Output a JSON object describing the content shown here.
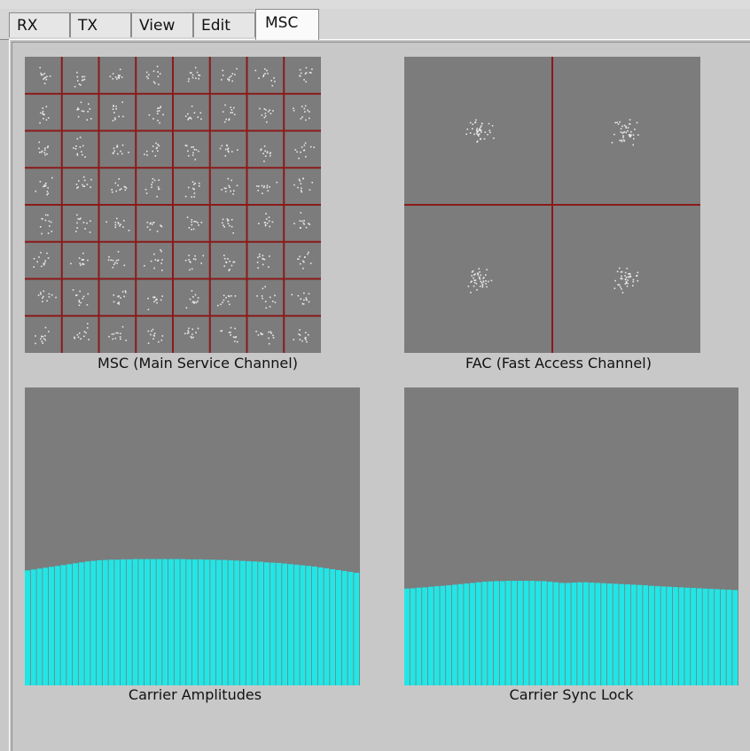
{
  "tabs": [
    {
      "label": "RX"
    },
    {
      "label": "TX"
    },
    {
      "label": "View"
    },
    {
      "label": "Edit"
    },
    {
      "label": "MSC"
    }
  ],
  "active_tab": "MSC",
  "colors": {
    "plot_background": "#7c7c7c",
    "grid_lines": "#8b1a1a",
    "constellation_points": "#e8e8e8",
    "carrier_bars": "#22e6e6"
  },
  "plots": {
    "msc": {
      "caption": "MSC (Main Service Channel)",
      "grid": "8x8 (64-QAM)",
      "clusters_per_side": 8
    },
    "fac": {
      "caption": "FAC (Fast Access Channel)",
      "grid": "2x2 (QPSK)",
      "clusters_per_side": 2
    },
    "amplitudes": {
      "caption": "Carrier Amplitudes"
    },
    "sync": {
      "caption": "Carrier Sync Lock"
    }
  },
  "chart_data": [
    {
      "type": "bar",
      "title": "Carrier Amplitudes",
      "ylim": [
        0,
        1
      ],
      "values": [
        0.386,
        0.389,
        0.392,
        0.395,
        0.398,
        0.401,
        0.404,
        0.407,
        0.41,
        0.413,
        0.416,
        0.418,
        0.42,
        0.421,
        0.422,
        0.422,
        0.423,
        0.423,
        0.424,
        0.424,
        0.424,
        0.424,
        0.424,
        0.424,
        0.424,
        0.424,
        0.424,
        0.423,
        0.423,
        0.423,
        0.422,
        0.422,
        0.421,
        0.421,
        0.42,
        0.419,
        0.418,
        0.417,
        0.416,
        0.415,
        0.413,
        0.412,
        0.411,
        0.409,
        0.407,
        0.405,
        0.403,
        0.401,
        0.399,
        0.396,
        0.393,
        0.39,
        0.387,
        0.384,
        0.381,
        0.378
      ]
    },
    {
      "type": "bar",
      "title": "Carrier Sync Lock",
      "ylim": [
        0,
        1
      ],
      "values": [
        0.325,
        0.326,
        0.328,
        0.329,
        0.331,
        0.333,
        0.334,
        0.336,
        0.338,
        0.34,
        0.342,
        0.344,
        0.346,
        0.348,
        0.349,
        0.35,
        0.35,
        0.351,
        0.351,
        0.351,
        0.351,
        0.351,
        0.35,
        0.35,
        0.348,
        0.346,
        0.344,
        0.344,
        0.345,
        0.346,
        0.346,
        0.345,
        0.344,
        0.343,
        0.342,
        0.341,
        0.34,
        0.339,
        0.338,
        0.337,
        0.336,
        0.334,
        0.333,
        0.332,
        0.331,
        0.33,
        0.329,
        0.328,
        0.327,
        0.326,
        0.325,
        0.324,
        0.323,
        0.322,
        0.321,
        0.32
      ]
    }
  ]
}
